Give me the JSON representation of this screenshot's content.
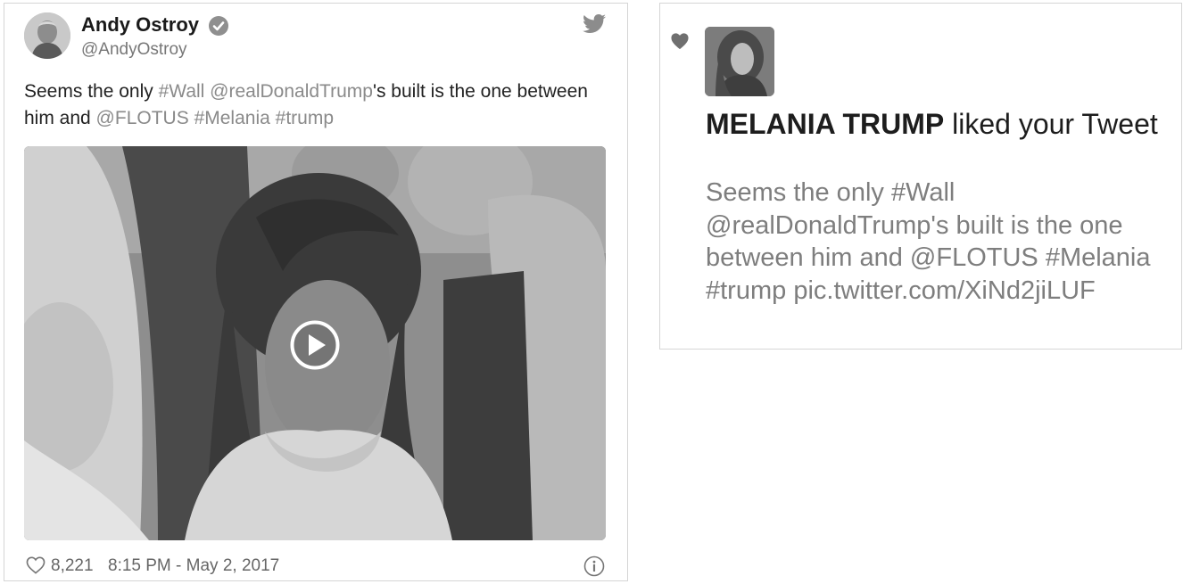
{
  "tweet": {
    "author_name": "Andy Ostroy",
    "handle": "@AndyOstroy",
    "text": {
      "p1": "Seems the only ",
      "l1": "#Wall",
      "p2": " ",
      "l2": "@realDonaldTrump",
      "p3": "'s built is the one between him and ",
      "l3": "@FLOTUS",
      "p4": " ",
      "l4": "#Melania",
      "p5": " ",
      "l5": "#trump"
    },
    "likes": "8,221",
    "timestamp": "8:15 PM - May 2, 2017",
    "icons": {
      "verified": "verified-badge-icon",
      "bird": "twitter-bird-icon",
      "play": "play-icon",
      "like": "heart-outline-icon",
      "info": "info-icon"
    }
  },
  "notification": {
    "liker_name": "MELANIA TRUMP",
    "action": " liked your Tweet",
    "tweet_text": "Seems the only #Wall @realDonaldTrump's built is the one between him and @FLOTUS #Melania #trump  pic.twitter.com/XiNd2jiLUF",
    "icon": "heart-icon"
  },
  "colors": {
    "text": "#1d1d1d",
    "link": "#8a8a8a",
    "muted": "#7e7e7e",
    "border": "#d5d5d5"
  }
}
